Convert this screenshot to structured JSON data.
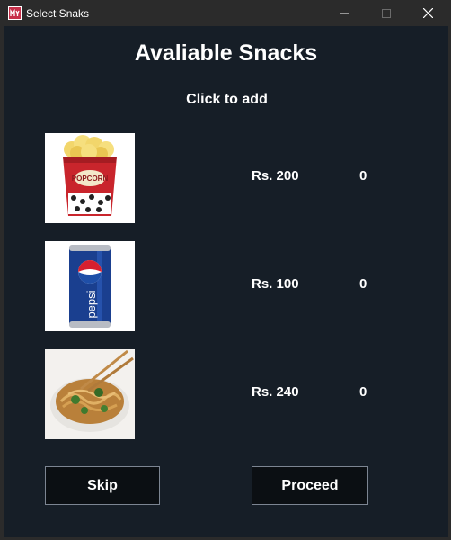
{
  "window": {
    "title": "Select Snaks",
    "app_icon": "app-icon",
    "controls": [
      "minimize-icon",
      "maximize-icon",
      "close-icon"
    ]
  },
  "header": {
    "title": "Avaliable Snacks",
    "subtitle": "Click to add"
  },
  "snacks": [
    {
      "name": "popcorn",
      "image_icon": "popcorn-icon",
      "price": "Rs. 200",
      "count": "0"
    },
    {
      "name": "pepsi",
      "image_icon": "pepsi-can-icon",
      "price": "Rs. 100",
      "count": "0"
    },
    {
      "name": "noodles",
      "image_icon": "noodles-icon",
      "price": "Rs. 240",
      "count": "0"
    }
  ],
  "buttons": {
    "skip": "Skip",
    "proceed": "Proceed"
  },
  "colors": {
    "background": "#161e27",
    "titlebar": "#2b2b2b",
    "button_bg": "#0b0f13",
    "button_border": "#7c8592",
    "text": "#ffffff"
  }
}
